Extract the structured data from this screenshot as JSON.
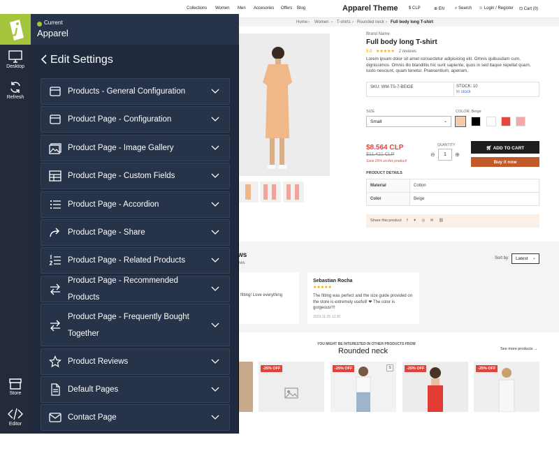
{
  "site": {
    "nav": [
      "Collections",
      "Women",
      "Men",
      "Accesories",
      "Offers",
      "Blog"
    ],
    "brand": "Apparel Theme",
    "currency": "CLP",
    "language": "EN",
    "search": "Search",
    "login": "Login / Register",
    "cart": "Cart (0)",
    "breadcrumb": [
      "Home",
      "Women",
      "T-shirts",
      "Rounded neck",
      "Full body long T-shirt"
    ],
    "product": {
      "brand": "Brand Name",
      "title": "Full body long T-shirt",
      "rating": "5.0",
      "reviews": "2 reviews",
      "description": "Lorem ipsum dolor sit amet consectetur adipisicing elit. Omnis quibusdam cum, dignissimos. Omnis illo blanditiis hic sunt sapiente, quos in sed itaque repellat quam. Iusto nesciunt, quam tenetur. Praesentium, aperiam.",
      "sku": "SKU: WM-TS-7-BEIGE",
      "stock": "STOCK: 10",
      "in_stock": "In stock",
      "size_label": "SIZE",
      "size_value": "Small",
      "color_label": "COLOR: Beige",
      "swatches": [
        "#f6c9a3",
        "#000000",
        "#ffffff",
        "#e8453c",
        "#f4a9a8"
      ],
      "price": "$8.564 CLP",
      "old_price": "$11.421 CLP",
      "save": "Save 25% on this product!",
      "qty_label": "QUANTITY",
      "qty": "1",
      "add_to_cart": "ADD TO CART",
      "buy_now": "Buy it now",
      "details_label": "PRODUCT DETAILS",
      "details": [
        [
          "Material",
          "Cotton"
        ],
        [
          "Color",
          "Beige"
        ]
      ],
      "share": "Share this product"
    },
    "reviews_fragment": "ws",
    "reviews_sub_fragment": "ews",
    "sort_label": "Sort by:",
    "sort_value": "Latest",
    "review_left_fragment": "fitting! Love everything",
    "reviewer": "Sebastian Rocha",
    "review_text": "The fitting was perfect and the size guide provided on the store is extremely usefull! ❤ The color is gorgeous!!!!",
    "review_date": "2023-11-25 12:30",
    "related_kicker": "YOU MIGHT BE INTERESTED IN OTHER PRODUCTS FROM",
    "related_title": "Rounded neck",
    "see_more": "See more products",
    "badge": "-25% OFF",
    "size_badge": "S"
  },
  "rail": {
    "desktop": "Desktop",
    "refresh": "Refresh",
    "store": "Store",
    "editor": "Editor"
  },
  "panel": {
    "current": "Current",
    "theme": "Apparel",
    "title": "Edit Settings",
    "items": [
      {
        "label": "Products - General Configuration",
        "icon": "window-icon"
      },
      {
        "label": "Product Page - Configuration",
        "icon": "window-icon"
      },
      {
        "label": "Product Page - Image Gallery",
        "icon": "gallery-icon"
      },
      {
        "label": "Product Page - Custom Fields",
        "icon": "table-icon"
      },
      {
        "label": "Product Page - Accordion",
        "icon": "list-icon"
      },
      {
        "label": "Product Page - Share",
        "icon": "share-arrow-icon"
      },
      {
        "label": "Product Page - Related Products",
        "icon": "numbered-list-icon"
      },
      {
        "label": "Product Page - Recommended Products",
        "icon": "swap-arrows-icon"
      },
      {
        "label": "Product Page - Frequently Bought Together",
        "icon": "swap-arrows-icon"
      },
      {
        "label": "Product Reviews",
        "icon": "star-icon"
      },
      {
        "label": "Default Pages",
        "icon": "document-icon"
      },
      {
        "label": "Contact Page",
        "icon": "envelope-icon"
      }
    ]
  },
  "colors": {
    "rail": "#232b3b",
    "panel": "#1f2a3d",
    "row": "#263349",
    "accent_green": "#a4c43c",
    "price_red": "#e0433c",
    "buy_now": "#c05a2a",
    "add_to_cart": "#1e1e1e"
  }
}
